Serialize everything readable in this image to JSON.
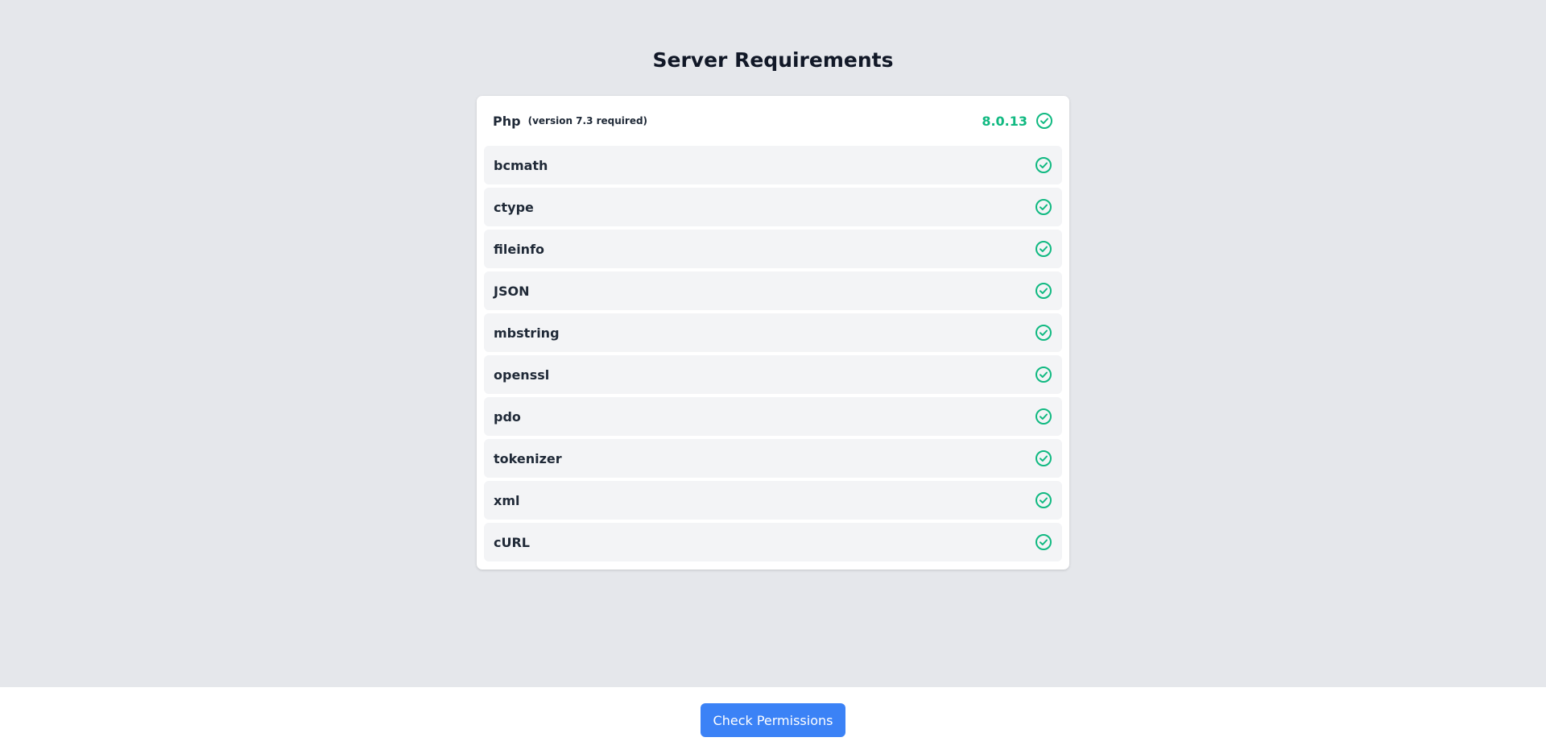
{
  "title": "Server Requirements",
  "php": {
    "name": "Php",
    "note": "(version 7.3 required)",
    "version": "8.0.13",
    "status_icon": "check-circle-icon"
  },
  "extensions": [
    {
      "name": "bcmath",
      "status_icon": "check-circle-icon"
    },
    {
      "name": "ctype",
      "status_icon": "check-circle-icon"
    },
    {
      "name": "fileinfo",
      "status_icon": "check-circle-icon"
    },
    {
      "name": "JSON",
      "status_icon": "check-circle-icon"
    },
    {
      "name": "mbstring",
      "status_icon": "check-circle-icon"
    },
    {
      "name": "openssl",
      "status_icon": "check-circle-icon"
    },
    {
      "name": "pdo",
      "status_icon": "check-circle-icon"
    },
    {
      "name": "tokenizer",
      "status_icon": "check-circle-icon"
    },
    {
      "name": "xml",
      "status_icon": "check-circle-icon"
    },
    {
      "name": "cURL",
      "status_icon": "check-circle-icon"
    }
  ],
  "footer": {
    "button_label": "Check Permissions"
  },
  "colors": {
    "success": "#10b981",
    "primary": "#3b82f6",
    "page_background": "#e5e7eb",
    "row_background": "#f3f4f6"
  }
}
